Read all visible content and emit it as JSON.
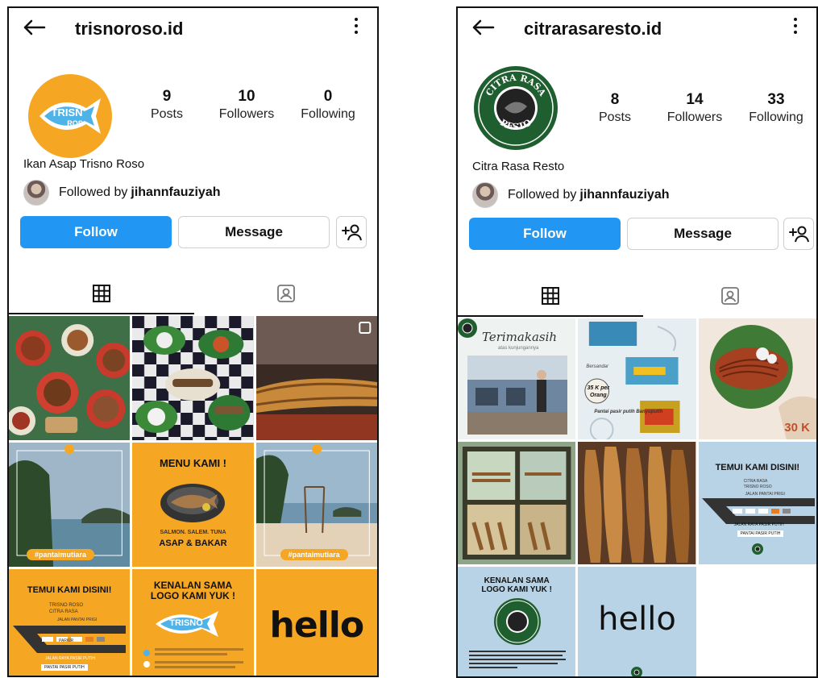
{
  "profiles": [
    {
      "username": "trisnoroso.id",
      "avatar_text": "TRISNO ROSO",
      "stats": [
        {
          "num": "9",
          "label": "Posts"
        },
        {
          "num": "10",
          "label": "Followers"
        },
        {
          "num": "0",
          "label": "Following"
        }
      ],
      "display_name": "Ikan Asap Trisno Roso",
      "followed_by_prefix": "Followed by",
      "followed_by_user": "jihannfauziyah",
      "buttons": {
        "follow": "Follow",
        "message": "Message"
      },
      "tiles": [
        {
          "text": ""
        },
        {
          "text": ""
        },
        {
          "text": ""
        },
        {
          "text": "#pantaimutiara"
        },
        {
          "text": "MENU KAMI !",
          "sub": "SALMON. SALEM. TUNA",
          "sub2": "ASAP & BAKAR"
        },
        {
          "text": "#pantaimutiara"
        },
        {
          "text": "TEMUI KAMI DISINI!",
          "l1": "TRISNO ROSO",
          "l2": "CITRA RASA",
          "l3": "JALAN PANTAI PRIGI",
          "l4": "PARKIR",
          "l5": "JALAN RAYA PASIR PUTIH",
          "l6": "PANTAI PASIR PUTIH"
        },
        {
          "text": "KENALAN SAMA LOGO KAMI YUK !",
          "logo": "TRISNO ROSO"
        },
        {
          "text": "hello"
        }
      ],
      "colors": {
        "orange": "#f5a623",
        "accent": "#2196f3"
      }
    },
    {
      "username": "citrarasaresto.id",
      "avatar_text_top": "CITRA RASA",
      "avatar_text_bottom": "RESTO",
      "stats": [
        {
          "num": "8",
          "label": "Posts"
        },
        {
          "num": "14",
          "label": "Followers"
        },
        {
          "num": "33",
          "label": "Following"
        }
      ],
      "display_name": "Citra Rasa Resto",
      "followed_by_prefix": "Followed by",
      "followed_by_user": "jihannfauziyah",
      "buttons": {
        "follow": "Follow",
        "message": "Message"
      },
      "tiles": [
        {
          "text": "Terimakasih",
          "sub": "atas kunjungannya"
        },
        {
          "text": "Bersandar",
          "sub": "35 K per Orang",
          "sub2": "Pantai pasir putih Banyuputih"
        },
        {
          "text": "30 K"
        },
        {
          "text": ""
        },
        {
          "text": ""
        },
        {
          "text": "TEMUI KAMI DISINI!",
          "l1": "CITRA RASA",
          "l2": "TRISNO ROSO",
          "l3": "JALAN PANTAI PRIGI",
          "l4": "PARKIR",
          "l5": "JALAN RAYA PASIR PUTIH",
          "l6": "PANTAI PASIR PUTIH"
        },
        {
          "text": "KENALAN SAMA LOGO KAMI YUK !",
          "logo": "CITRA RASA RESTO"
        },
        {
          "text": "hello"
        }
      ],
      "colors": {
        "green": "#1f5e2e",
        "lightblue": "#b9d3e6"
      }
    }
  ]
}
